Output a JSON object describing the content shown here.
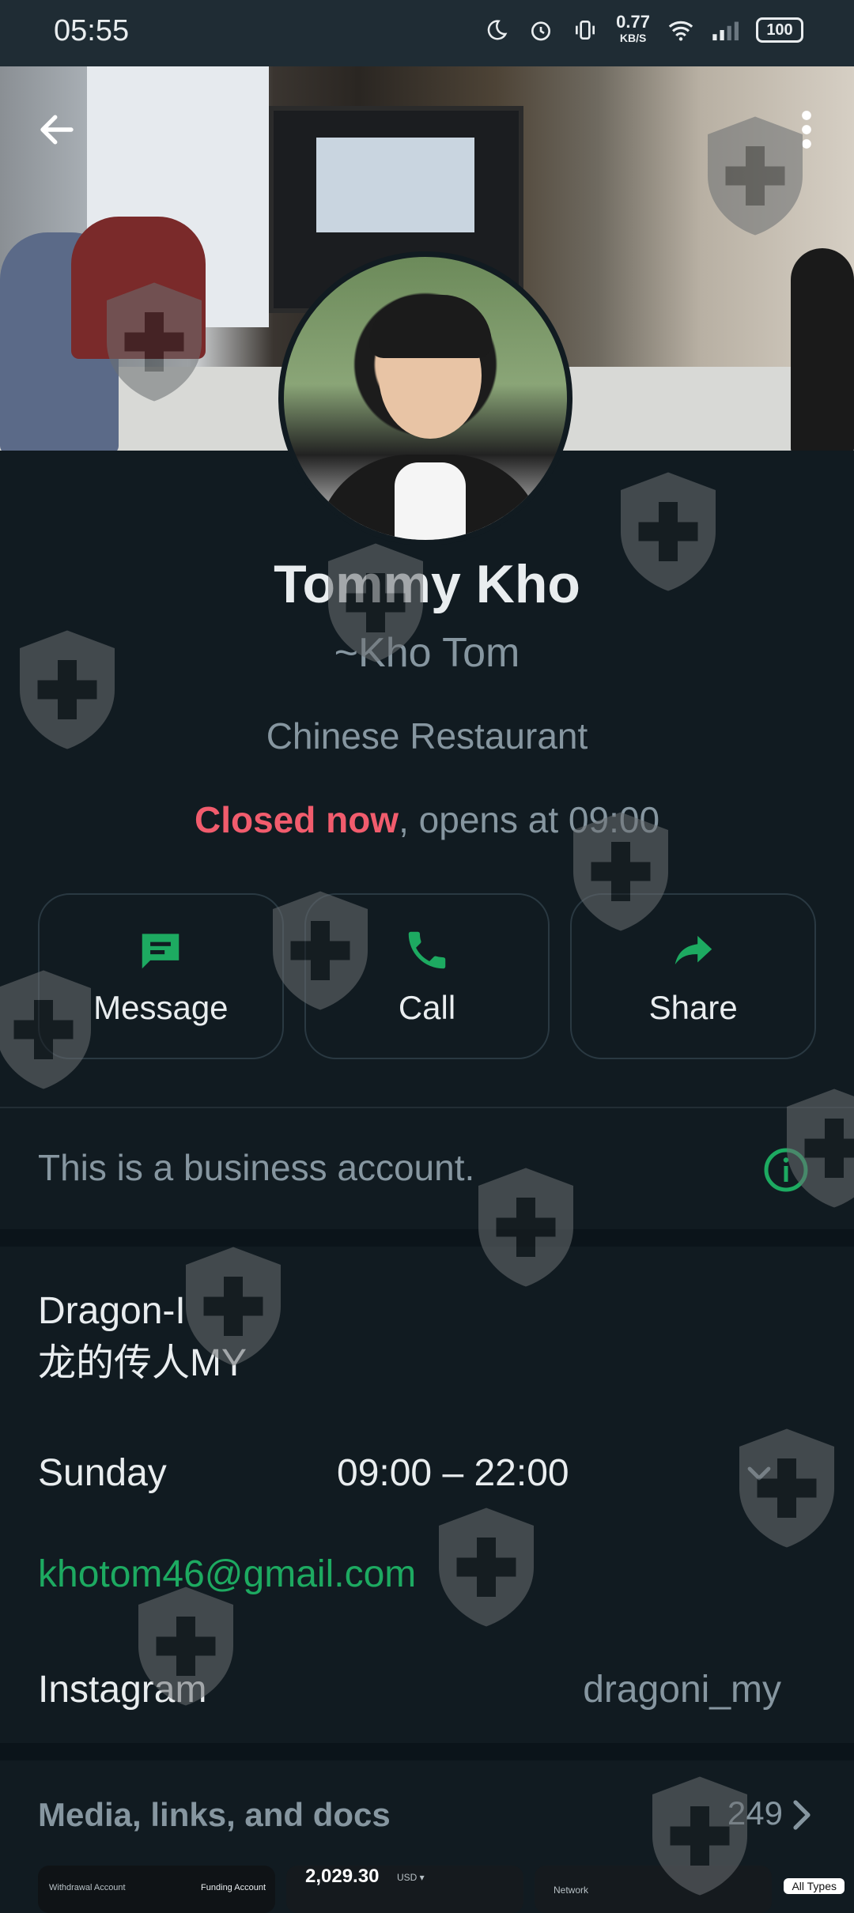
{
  "status_bar": {
    "time": "05:55",
    "net_speed_value": "0.77",
    "net_speed_unit": "KB/S",
    "battery": "100",
    "icons": [
      "moon-icon",
      "alarm-icon",
      "vibrate-icon",
      "wifi-icon",
      "signal-icon",
      "battery-icon"
    ]
  },
  "header": {
    "back_icon": "arrow-back-icon",
    "menu_icon": "more-vertical-icon"
  },
  "profile": {
    "name": "Tommy Kho",
    "nickname": "~Kho Tom",
    "category": "Chinese Restaurant",
    "hours_status_closed": "Closed now",
    "hours_status_rest": ", opens at 09:00"
  },
  "actions": [
    {
      "label": "Message",
      "icon": "message-icon"
    },
    {
      "label": "Call",
      "icon": "phone-icon"
    },
    {
      "label": "Share",
      "icon": "share-icon"
    }
  ],
  "business_note": "This is a business account.",
  "details": {
    "business_name_line1": "Dragon-I",
    "business_name_line2": "龙的传人MY",
    "day": "Sunday",
    "time_range": "09:00 – 22:00",
    "email": "khotom46@gmail.com",
    "instagram_label": "Instagram",
    "instagram_handle": "dragoni_my"
  },
  "media": {
    "label": "Media, links, and docs",
    "count": "249",
    "thumb1_left": "Withdrawal Account",
    "thumb1_right": "Funding Account",
    "thumb2_value": "2,029.30",
    "thumb2_unit": "USD ▾",
    "thumb3_text": "Network",
    "all_types": "All Types"
  },
  "colors": {
    "background": "#111b21",
    "accent": "#1daa61",
    "closed": "#f15c6d",
    "muted": "#8696a0"
  }
}
